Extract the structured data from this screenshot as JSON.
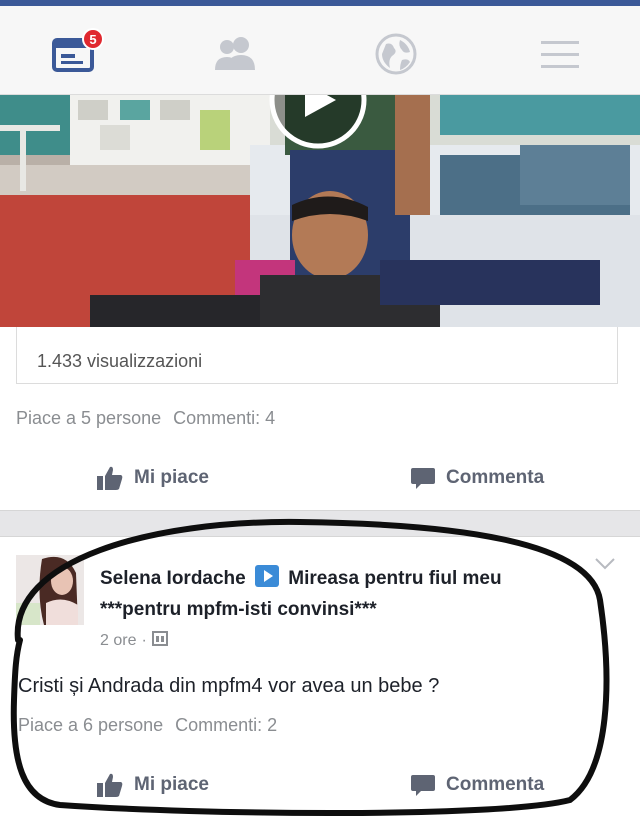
{
  "nav": {
    "items": [
      {
        "icon": "news-feed-icon",
        "badge": "5"
      },
      {
        "icon": "friends-icon"
      },
      {
        "icon": "globe-icon"
      },
      {
        "icon": "menu-icon"
      }
    ],
    "accent": "#3b5998",
    "badge_color": "#e0282f"
  },
  "post1": {
    "views": "1.433 visualizzazioni",
    "likes": "Piace a 5 persone",
    "comments": "Commenti: 4",
    "like_label": "Mi piace",
    "comment_label": "Commenta"
  },
  "post2": {
    "author": "Selena Iordache",
    "page": "Mireasa pentru fiul meu ***pentru mpfm-isti convinsi***",
    "time": "2 ore",
    "text": "Cristi și Andrada din mpfm4 vor avea un bebe ?",
    "likes": "Piace a 6 persone",
    "comments": "Commenti: 2",
    "like_label": "Mi piace",
    "comment_label": "Commenta"
  }
}
